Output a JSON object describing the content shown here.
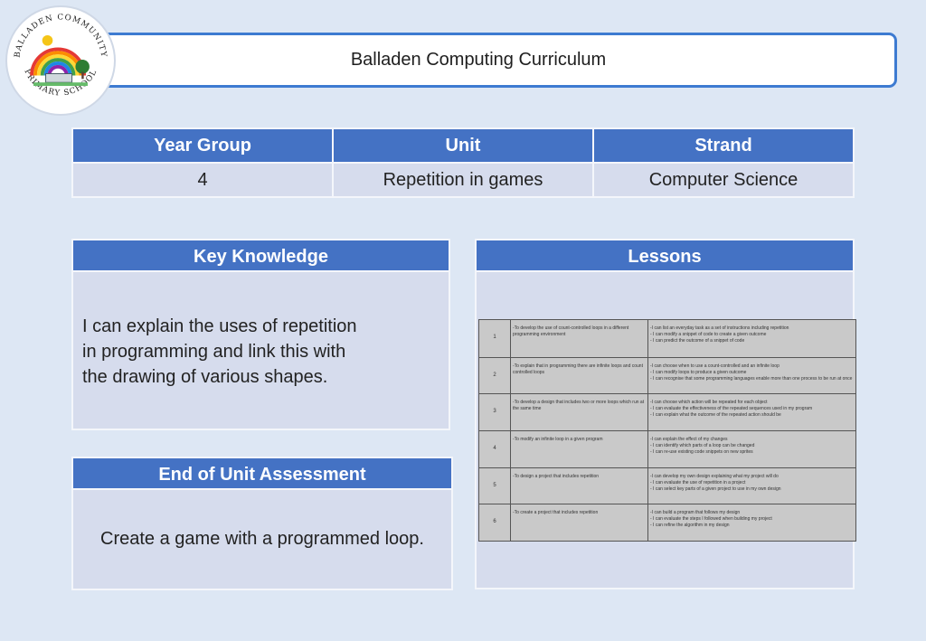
{
  "logo": {
    "text_top": "BALLADEN COMMUNITY",
    "text_bottom": "PRIMARY SCHOOL"
  },
  "title": "Balladen Computing Curriculum",
  "overview": {
    "headers": [
      "Year Group",
      "Unit",
      "Strand"
    ],
    "values": [
      "4",
      "Repetition in games",
      "Computer Science"
    ]
  },
  "key_knowledge": {
    "heading": "Key Knowledge",
    "lines": [
      "I can explain the uses of repetition",
      "in programming and link this with",
      "the drawing of various shapes."
    ]
  },
  "assessment": {
    "heading": "End of Unit Assessment",
    "text": "Create a game with a programmed loop."
  },
  "lessons": {
    "heading": "Lessons",
    "rows": [
      {
        "num": "1",
        "objective": "-To develop the use of count-controlled loops in a different programming environment",
        "outcomes": [
          "-I can list an everyday task as a set of instructions including repetition",
          "- I can modify a snippet of code to create a given outcome",
          "- I can predict the outcome of a snippet of code"
        ]
      },
      {
        "num": "2",
        "objective": "-To explain that in programming there are infinite loops and count controlled loops",
        "outcomes": [
          "-I can choose when to use a count-controlled and an infinite loop",
          "- I can modify loops to produce a given outcome",
          "- I can recognise that some programming languages enable more than one process to be run at once"
        ]
      },
      {
        "num": "3",
        "objective": "-To develop a design that includes two or more loops which run at the same time",
        "outcomes": [
          "-I can choose which action will be repeated for each object",
          "- I can evaluate the effectiveness of the repeated sequences used in my program",
          "- I can explain what the outcome of the repeated action should be"
        ]
      },
      {
        "num": "4",
        "objective": "-To modify an infinite loop in a given program",
        "outcomes": [
          "-I can explain the effect of my changes",
          "- I can identify which parts of a loop can be changed",
          "- I can re-use existing code snippets on new sprites"
        ]
      },
      {
        "num": "5",
        "objective": "-To design a project that includes repetition",
        "outcomes": [
          "-I can develop my own design explaining what my project will do",
          "- I can evaluate the use of repetition in a project",
          "- I can select key parts of a given project to use in my own design"
        ]
      },
      {
        "num": "6",
        "objective": "-To create a project that includes repetition",
        "outcomes": [
          "-I can build a program that follows my design",
          "- I can evaluate the steps I followed when building my project",
          "- I can refine the algorithm in my design"
        ]
      }
    ]
  }
}
